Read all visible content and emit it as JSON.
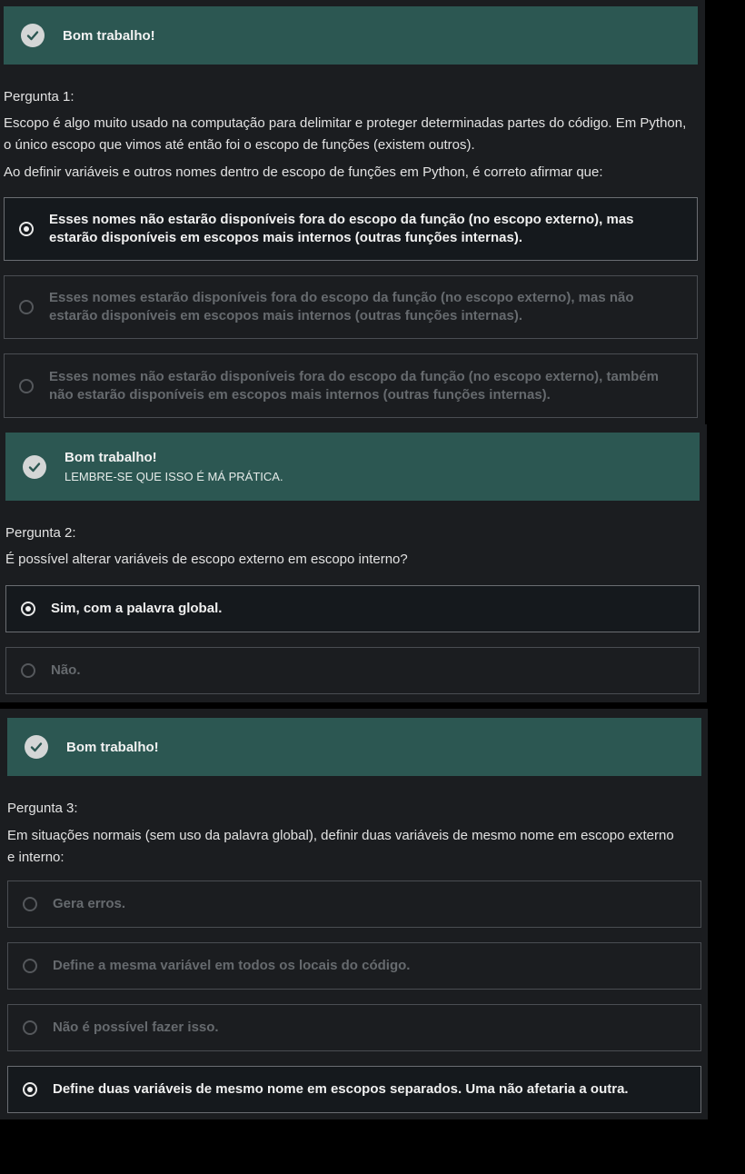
{
  "colors": {
    "banner_bg": "#2c5752",
    "panel_bg": "#1b1d20",
    "page_bg": "#000000",
    "selected_option_bg": "#15191d",
    "unselected_text": "#666a6e"
  },
  "sections": [
    {
      "feedback": {
        "icon": "check-circle-icon",
        "title": "Bom trabalho!",
        "subtitle": ""
      },
      "question_label": "Pergunta 1:",
      "question_text": [
        "Escopo é algo muito usado na computação para delimitar e proteger determinadas partes do código. Em Python, o único escopo que vimos até então foi o escopo de funções (existem outros).",
        "Ao definir variáveis e outros nomes dentro de escopo de funções em Python, é correto afirmar que:"
      ],
      "options": [
        {
          "label": "Esses nomes não estarão disponíveis fora do escopo da função (no escopo externo), mas estarão disponíveis em escopos mais internos (outras funções internas).",
          "selected": true
        },
        {
          "label": "Esses nomes estarão disponíveis fora do escopo da função (no escopo externo), mas não estarão disponíveis em escopos mais internos (outras funções internas).",
          "selected": false
        },
        {
          "label": "Esses nomes não estarão disponíveis fora do escopo da função (no escopo externo), também não estarão disponíveis em escopos mais internos (outras funções internas).",
          "selected": false
        }
      ]
    },
    {
      "feedback": {
        "icon": "check-circle-icon",
        "title": "Bom trabalho!",
        "subtitle": "LEMBRE-SE QUE ISSO É MÁ PRÁTICA."
      },
      "question_label": "Pergunta 2:",
      "question_text": [
        "É possível alterar variáveis de escopo externo em escopo interno?"
      ],
      "options": [
        {
          "label": "Sim, com a palavra global.",
          "selected": true
        },
        {
          "label": "Não.",
          "selected": false
        }
      ]
    },
    {
      "feedback": {
        "icon": "check-circle-icon",
        "title": "Bom trabalho!",
        "subtitle": ""
      },
      "question_label": "Pergunta 3:",
      "question_text": [
        "Em situações normais (sem uso da palavra global), definir duas variáveis de mesmo nome em escopo externo e interno:"
      ],
      "options": [
        {
          "label": "Gera erros.",
          "selected": false
        },
        {
          "label": "Define a mesma variável em todos os locais do código.",
          "selected": false
        },
        {
          "label": "Não é possível fazer isso.",
          "selected": false
        },
        {
          "label": "Define duas variáveis de mesmo nome em escopos separados. Uma não afetaria a outra.",
          "selected": true
        }
      ]
    }
  ]
}
